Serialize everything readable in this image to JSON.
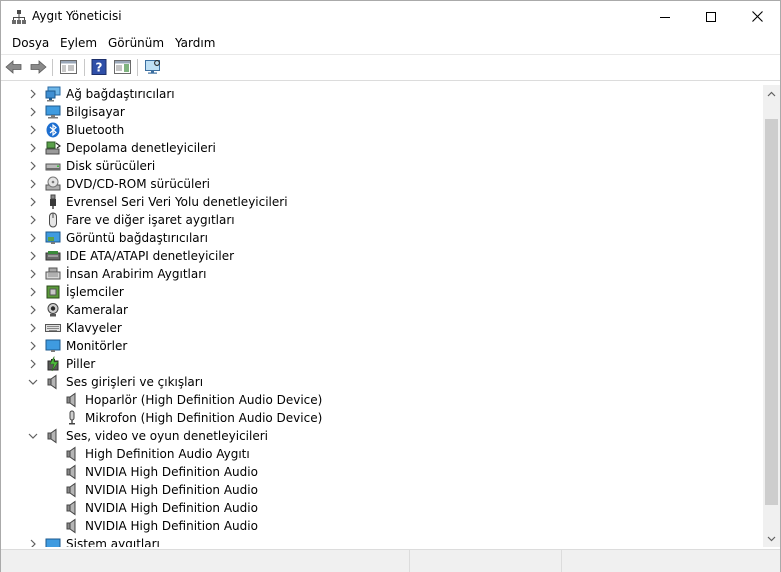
{
  "window": {
    "title": "Aygıt Yöneticisi"
  },
  "menu": {
    "file": "Dosya",
    "action": "Eylem",
    "view": "Görünüm",
    "help": "Yardım"
  },
  "tree": {
    "items": [
      {
        "label": "Ağ bağdaştırıcıları",
        "icon": "network-adapter-icon",
        "expanded": false
      },
      {
        "label": "Bilgisayar",
        "icon": "computer-icon",
        "expanded": false
      },
      {
        "label": "Bluetooth",
        "icon": "bluetooth-icon",
        "expanded": false
      },
      {
        "label": "Depolama denetleyicileri",
        "icon": "storage-controller-icon",
        "expanded": false
      },
      {
        "label": "Disk sürücüleri",
        "icon": "disk-drive-icon",
        "expanded": false
      },
      {
        "label": "DVD/CD-ROM sürücüleri",
        "icon": "dvd-icon",
        "expanded": false
      },
      {
        "label": "Evrensel Seri Veri Yolu denetleyicileri",
        "icon": "usb-icon",
        "expanded": false
      },
      {
        "label": "Fare ve diğer işaret aygıtları",
        "icon": "mouse-icon",
        "expanded": false
      },
      {
        "label": "Görüntü bağdaştırıcıları",
        "icon": "display-adapter-icon",
        "expanded": false
      },
      {
        "label": "IDE ATA/ATAPI denetleyiciler",
        "icon": "ide-icon",
        "expanded": false
      },
      {
        "label": "İnsan Arabirim Aygıtları",
        "icon": "hid-icon",
        "expanded": false
      },
      {
        "label": "İşlemciler",
        "icon": "processor-icon",
        "expanded": false
      },
      {
        "label": "Kameralar",
        "icon": "camera-icon",
        "expanded": false
      },
      {
        "label": "Klavyeler",
        "icon": "keyboard-icon",
        "expanded": false
      },
      {
        "label": "Monitörler",
        "icon": "monitor-icon",
        "expanded": false
      },
      {
        "label": "Piller",
        "icon": "battery-icon",
        "expanded": false
      },
      {
        "label": "Ses girişleri ve çıkışları",
        "icon": "speaker-icon",
        "expanded": true
      },
      {
        "label": "Hoparlör (High Definition Audio Device)",
        "icon": "speaker-icon",
        "child": true
      },
      {
        "label": "Mikrofon (High Definition Audio Device)",
        "icon": "microphone-icon",
        "child": true
      },
      {
        "label": "Ses, video ve oyun denetleyicileri",
        "icon": "speaker-icon",
        "expanded": true
      },
      {
        "label": "High Definition Audio Aygıtı",
        "icon": "speaker-icon",
        "child": true
      },
      {
        "label": "NVIDIA High Definition Audio",
        "icon": "speaker-icon",
        "child": true
      },
      {
        "label": "NVIDIA High Definition Audio",
        "icon": "speaker-icon",
        "child": true
      },
      {
        "label": "NVIDIA High Definition Audio",
        "icon": "speaker-icon",
        "child": true
      },
      {
        "label": "NVIDIA High Definition Audio",
        "icon": "speaker-icon",
        "child": true
      },
      {
        "label": "Sistem aygıtları",
        "icon": "system-device-icon",
        "expanded": false
      }
    ]
  }
}
